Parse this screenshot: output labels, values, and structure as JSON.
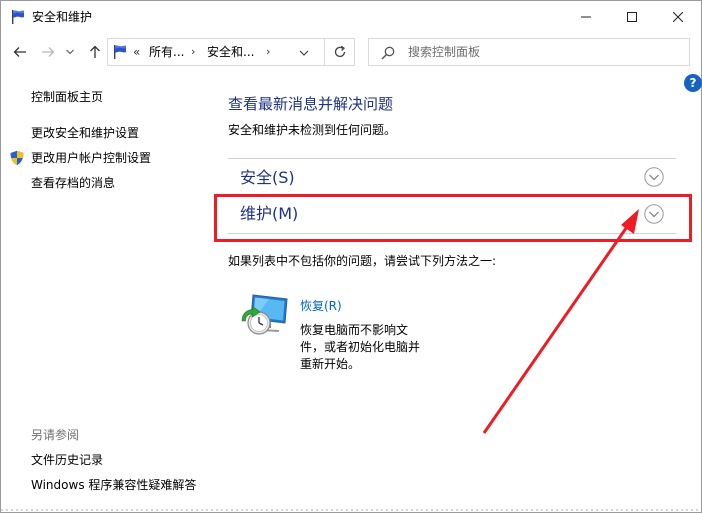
{
  "window": {
    "title": "安全和维护"
  },
  "addressbar": {
    "chevron": "«",
    "crumb1": "所有...",
    "sep": "›",
    "crumb2": "安全和...",
    "search_placeholder": "搜索控制面板"
  },
  "help": {
    "glyph": "?"
  },
  "sidebar": {
    "home": "控制面板主页",
    "items": [
      "更改安全和维护设置",
      "更改用户帐户控制设置",
      "查看存档的消息"
    ],
    "see_also_title": "另请参阅",
    "see_also_items": [
      "文件历史记录",
      "Windows 程序兼容性疑难解答"
    ]
  },
  "main": {
    "heading": "查看最新消息并解决问题",
    "subtext": "安全和维护未检测到任何问题。",
    "sections": [
      {
        "label": "安全(S)"
      },
      {
        "label": "维护(M)"
      }
    ],
    "try_text": "如果列表中不包括你的问题，请尝试下列方法之一:",
    "recovery": {
      "link": "恢复(R)",
      "desc": "恢复电脑而不影响文件，或者初始化电脑并重新开始。"
    }
  },
  "colors": {
    "heading_blue": "#1e3287",
    "link_blue": "#0066cc",
    "highlight_red": "#ee1c24"
  }
}
